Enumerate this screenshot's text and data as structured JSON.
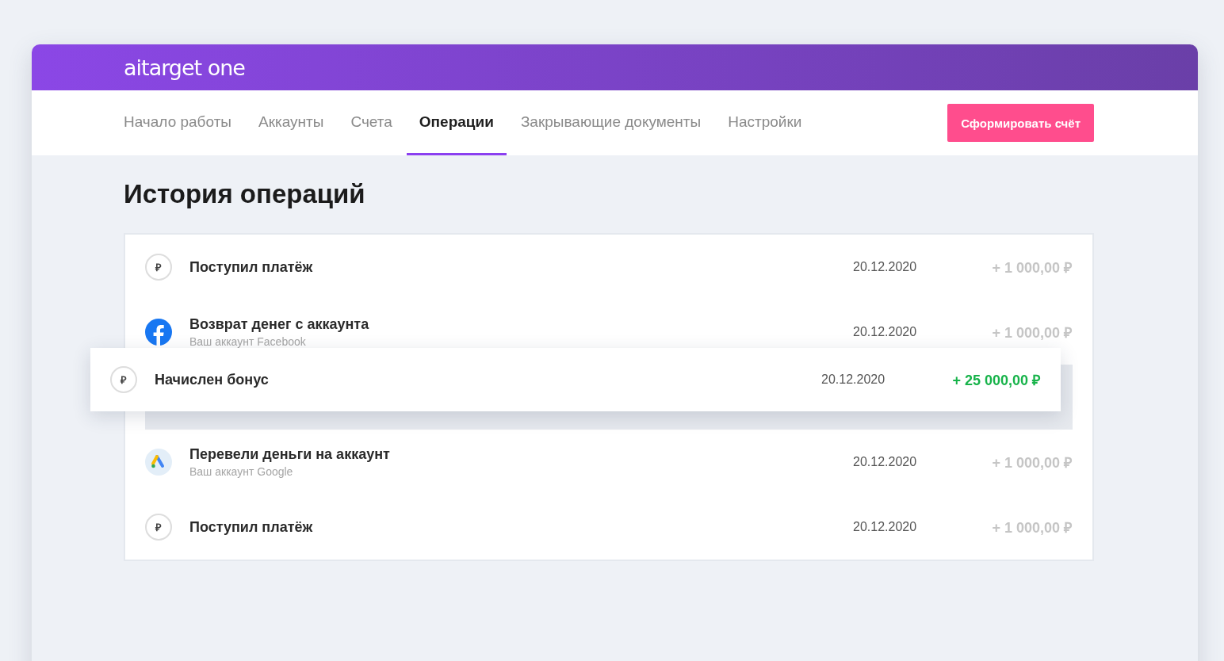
{
  "header": {
    "logo": "aitarget one"
  },
  "tabs": [
    {
      "label": "Начало работы",
      "selected": false
    },
    {
      "label": "Аккаунты",
      "selected": false
    },
    {
      "label": "Счета",
      "selected": false
    },
    {
      "label": "Операции",
      "selected": true
    },
    {
      "label": "Закрывающие документы",
      "selected": false
    },
    {
      "label": "Настройки",
      "selected": false
    }
  ],
  "action_button": "Сформировать счёт",
  "title": "История операций",
  "operations": [
    {
      "kind": "ruble",
      "icon_symbol": "₽",
      "title": "Поступил платёж",
      "date": "20.12.2020",
      "amount": "+ 1 000,00 ₽",
      "highlighted": false,
      "lifted": false
    },
    {
      "kind": "facebook",
      "title": "Возврат денег с аккаунта",
      "subtitle": "Ваш аккаунт Facebook",
      "date": "20.12.2020",
      "amount": "+ 1 000,00 ₽",
      "highlighted": false,
      "lifted": false
    },
    {
      "kind": "ruble",
      "icon_symbol": "₽",
      "title": "Начислен бонус",
      "date": "20.12.2020",
      "amount": "+ 25 000,00 ₽",
      "highlighted": true,
      "lifted": true
    },
    {
      "kind": "google",
      "title": "Перевели деньги на аккаунт",
      "subtitle": "Ваш аккаунт Google",
      "date": "20.12.2020",
      "amount": "+ 1 000,00 ₽",
      "highlighted": false,
      "lifted": false
    },
    {
      "kind": "ruble",
      "icon_symbol": "₽",
      "title": "Поступил платёж",
      "date": "20.12.2020",
      "amount": "+ 1 000,00 ₽",
      "highlighted": false,
      "lifted": false
    }
  ]
}
